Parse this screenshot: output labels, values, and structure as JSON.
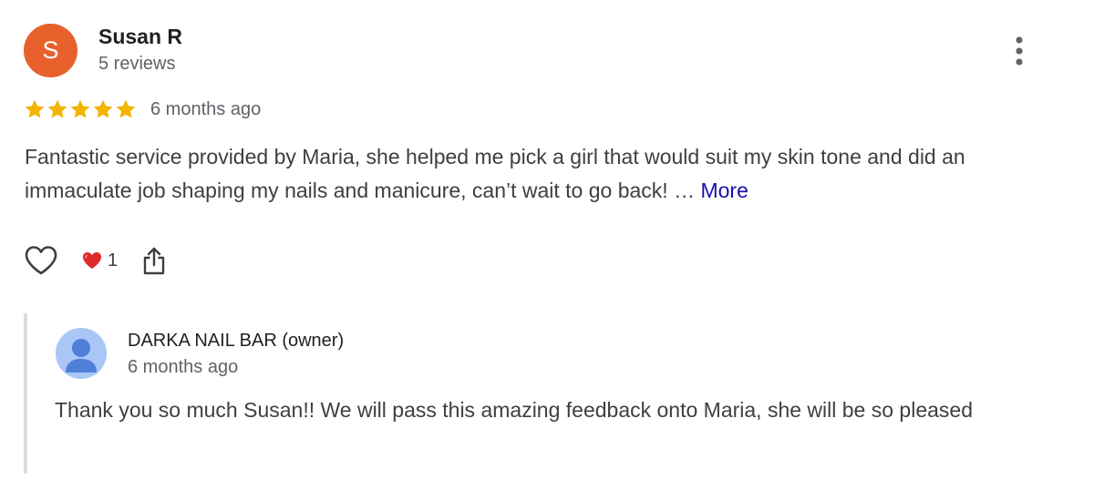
{
  "review": {
    "avatar_letter": "S",
    "avatar_color": "#e8612c",
    "reviewer_name": "Susan R",
    "reviewer_meta": "5 reviews",
    "rating": 5,
    "rating_max": 5,
    "date": "6 months ago",
    "text": "Fantastic service provided by Maria, she helped me pick a girl that would suit my skin tone and did an immaculate job shaping my nails and manicure, can’t wait to go back! … ",
    "more_label": "More",
    "menu_icon": "more-vert-icon"
  },
  "actions": {
    "like_icon": "heart-outline-icon",
    "reaction_icon": "red-heart-icon",
    "reaction_count": "1",
    "share_icon": "share-icon"
  },
  "owner_reply": {
    "owner_name": "DARKA NAIL BAR (owner)",
    "date": "6 months ago",
    "text": "Thank you so much Susan!! We will pass this amazing feedback onto Maria, she will be so pleased",
    "avatar_icon": "person-icon"
  },
  "colors": {
    "star": "#f4b400",
    "link": "#1a0dab",
    "heart": "#e02a2a",
    "owner_avatar_bg": "#a9c6f7",
    "owner_avatar_fg": "#4f7fd6"
  }
}
